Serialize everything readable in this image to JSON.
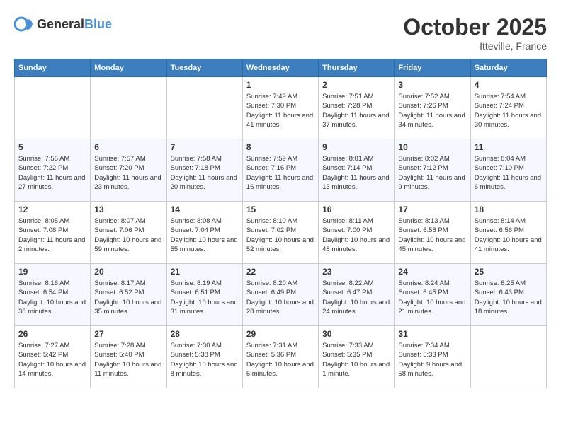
{
  "header": {
    "logo_general": "General",
    "logo_blue": "Blue",
    "month_title": "October 2025",
    "location": "Itteville, France"
  },
  "weekdays": [
    "Sunday",
    "Monday",
    "Tuesday",
    "Wednesday",
    "Thursday",
    "Friday",
    "Saturday"
  ],
  "weeks": [
    [
      {
        "day": "",
        "sunrise": "",
        "sunset": "",
        "daylight": ""
      },
      {
        "day": "",
        "sunrise": "",
        "sunset": "",
        "daylight": ""
      },
      {
        "day": "",
        "sunrise": "",
        "sunset": "",
        "daylight": ""
      },
      {
        "day": "1",
        "sunrise": "Sunrise: 7:49 AM",
        "sunset": "Sunset: 7:30 PM",
        "daylight": "Daylight: 11 hours and 41 minutes."
      },
      {
        "day": "2",
        "sunrise": "Sunrise: 7:51 AM",
        "sunset": "Sunset: 7:28 PM",
        "daylight": "Daylight: 11 hours and 37 minutes."
      },
      {
        "day": "3",
        "sunrise": "Sunrise: 7:52 AM",
        "sunset": "Sunset: 7:26 PM",
        "daylight": "Daylight: 11 hours and 34 minutes."
      },
      {
        "day": "4",
        "sunrise": "Sunrise: 7:54 AM",
        "sunset": "Sunset: 7:24 PM",
        "daylight": "Daylight: 11 hours and 30 minutes."
      }
    ],
    [
      {
        "day": "5",
        "sunrise": "Sunrise: 7:55 AM",
        "sunset": "Sunset: 7:22 PM",
        "daylight": "Daylight: 11 hours and 27 minutes."
      },
      {
        "day": "6",
        "sunrise": "Sunrise: 7:57 AM",
        "sunset": "Sunset: 7:20 PM",
        "daylight": "Daylight: 11 hours and 23 minutes."
      },
      {
        "day": "7",
        "sunrise": "Sunrise: 7:58 AM",
        "sunset": "Sunset: 7:18 PM",
        "daylight": "Daylight: 11 hours and 20 minutes."
      },
      {
        "day": "8",
        "sunrise": "Sunrise: 7:59 AM",
        "sunset": "Sunset: 7:16 PM",
        "daylight": "Daylight: 11 hours and 16 minutes."
      },
      {
        "day": "9",
        "sunrise": "Sunrise: 8:01 AM",
        "sunset": "Sunset: 7:14 PM",
        "daylight": "Daylight: 11 hours and 13 minutes."
      },
      {
        "day": "10",
        "sunrise": "Sunrise: 8:02 AM",
        "sunset": "Sunset: 7:12 PM",
        "daylight": "Daylight: 11 hours and 9 minutes."
      },
      {
        "day": "11",
        "sunrise": "Sunrise: 8:04 AM",
        "sunset": "Sunset: 7:10 PM",
        "daylight": "Daylight: 11 hours and 6 minutes."
      }
    ],
    [
      {
        "day": "12",
        "sunrise": "Sunrise: 8:05 AM",
        "sunset": "Sunset: 7:08 PM",
        "daylight": "Daylight: 11 hours and 2 minutes."
      },
      {
        "day": "13",
        "sunrise": "Sunrise: 8:07 AM",
        "sunset": "Sunset: 7:06 PM",
        "daylight": "Daylight: 10 hours and 59 minutes."
      },
      {
        "day": "14",
        "sunrise": "Sunrise: 8:08 AM",
        "sunset": "Sunset: 7:04 PM",
        "daylight": "Daylight: 10 hours and 55 minutes."
      },
      {
        "day": "15",
        "sunrise": "Sunrise: 8:10 AM",
        "sunset": "Sunset: 7:02 PM",
        "daylight": "Daylight: 10 hours and 52 minutes."
      },
      {
        "day": "16",
        "sunrise": "Sunrise: 8:11 AM",
        "sunset": "Sunset: 7:00 PM",
        "daylight": "Daylight: 10 hours and 48 minutes."
      },
      {
        "day": "17",
        "sunrise": "Sunrise: 8:13 AM",
        "sunset": "Sunset: 6:58 PM",
        "daylight": "Daylight: 10 hours and 45 minutes."
      },
      {
        "day": "18",
        "sunrise": "Sunrise: 8:14 AM",
        "sunset": "Sunset: 6:56 PM",
        "daylight": "Daylight: 10 hours and 41 minutes."
      }
    ],
    [
      {
        "day": "19",
        "sunrise": "Sunrise: 8:16 AM",
        "sunset": "Sunset: 6:54 PM",
        "daylight": "Daylight: 10 hours and 38 minutes."
      },
      {
        "day": "20",
        "sunrise": "Sunrise: 8:17 AM",
        "sunset": "Sunset: 6:52 PM",
        "daylight": "Daylight: 10 hours and 35 minutes."
      },
      {
        "day": "21",
        "sunrise": "Sunrise: 8:19 AM",
        "sunset": "Sunset: 6:51 PM",
        "daylight": "Daylight: 10 hours and 31 minutes."
      },
      {
        "day": "22",
        "sunrise": "Sunrise: 8:20 AM",
        "sunset": "Sunset: 6:49 PM",
        "daylight": "Daylight: 10 hours and 28 minutes."
      },
      {
        "day": "23",
        "sunrise": "Sunrise: 8:22 AM",
        "sunset": "Sunset: 6:47 PM",
        "daylight": "Daylight: 10 hours and 24 minutes."
      },
      {
        "day": "24",
        "sunrise": "Sunrise: 8:24 AM",
        "sunset": "Sunset: 6:45 PM",
        "daylight": "Daylight: 10 hours and 21 minutes."
      },
      {
        "day": "25",
        "sunrise": "Sunrise: 8:25 AM",
        "sunset": "Sunset: 6:43 PM",
        "daylight": "Daylight: 10 hours and 18 minutes."
      }
    ],
    [
      {
        "day": "26",
        "sunrise": "Sunrise: 7:27 AM",
        "sunset": "Sunset: 5:42 PM",
        "daylight": "Daylight: 10 hours and 14 minutes."
      },
      {
        "day": "27",
        "sunrise": "Sunrise: 7:28 AM",
        "sunset": "Sunset: 5:40 PM",
        "daylight": "Daylight: 10 hours and 11 minutes."
      },
      {
        "day": "28",
        "sunrise": "Sunrise: 7:30 AM",
        "sunset": "Sunset: 5:38 PM",
        "daylight": "Daylight: 10 hours and 8 minutes."
      },
      {
        "day": "29",
        "sunrise": "Sunrise: 7:31 AM",
        "sunset": "Sunset: 5:36 PM",
        "daylight": "Daylight: 10 hours and 5 minutes."
      },
      {
        "day": "30",
        "sunrise": "Sunrise: 7:33 AM",
        "sunset": "Sunset: 5:35 PM",
        "daylight": "Daylight: 10 hours and 1 minute."
      },
      {
        "day": "31",
        "sunrise": "Sunrise: 7:34 AM",
        "sunset": "Sunset: 5:33 PM",
        "daylight": "Daylight: 9 hours and 58 minutes."
      },
      {
        "day": "",
        "sunrise": "",
        "sunset": "",
        "daylight": ""
      }
    ]
  ]
}
